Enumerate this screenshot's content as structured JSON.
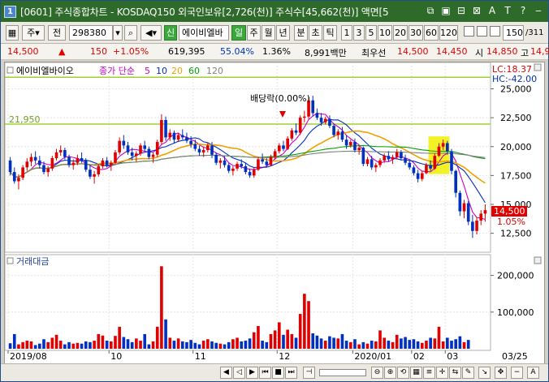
{
  "window": {
    "badge": "1",
    "title": "[0601] 주식종합차트 - KOSDAQ150 외국인보유[2,726(천)] 주식수[45,662(천)] 액면[5"
  },
  "title_icons": [
    "⧉",
    "▣",
    "⊟",
    "⊠",
    "A",
    "T",
    "?",
    "‒"
  ],
  "toolbar": {
    "type_label": "주",
    "prev_label": "전",
    "code_value": "298380",
    "search_icon": "magnifier-icon",
    "new_label": "신",
    "stock_name": "에이비엘바",
    "periods": [
      "일",
      "주",
      "월",
      "년",
      "분",
      "초",
      "틱"
    ],
    "multipliers": [
      "1",
      "3",
      "5",
      "10",
      "20",
      "30",
      "60",
      "120"
    ],
    "count_value": "150",
    "count_total": "/311"
  },
  "inforow": {
    "price": "14,500",
    "change": "150",
    "change_pct": "+1.05%",
    "volume": "619,395",
    "ratio1": "55.04%",
    "ratio2": "1.36%",
    "amount": "8,991백만",
    "pref_label": "최우선",
    "bid1": "14,500",
    "bid2": "14,450",
    "open_label": "시",
    "open": "14,850",
    "high_label": "고",
    "high": "14,9"
  },
  "chart": {
    "legend_name": "에이비엘바이오",
    "legend_ma_label": "종가 단순",
    "ma_periods": [
      "5",
      "10",
      "20",
      "60",
      "120"
    ],
    "ma_colors": [
      "#cc00cc",
      "#0030c0",
      "#f0a000",
      "#00a000",
      "#808080"
    ],
    "lc_label": "LC:18.37",
    "hc_label": "HC:-42.00",
    "resistance_label": "21,950",
    "dividend_label": "배당락(0.00%)",
    "price_ticks": [
      "25,000",
      "22,500",
      "20,000",
      "17,500",
      "15,000",
      "12,500"
    ],
    "current_price": "14,500",
    "current_pct": "1.05%",
    "volume_label": "거래대금",
    "volume_ticks": [
      "200,000",
      "100,000"
    ],
    "date_ticks": [
      "2019/08",
      "10",
      "11",
      "12",
      "2020/01",
      "02",
      "03"
    ],
    "last_date": "03/25"
  },
  "chart_data": {
    "type": "candlestick",
    "price_axis": {
      "min": 11000,
      "max": 27000,
      "ticks": [
        25000,
        22500,
        20000,
        17500,
        15000,
        12500
      ]
    },
    "volume_axis": {
      "max": 250000,
      "ticks": [
        200000,
        100000
      ]
    },
    "resistance": 21950,
    "support": 26000,
    "candles": [
      [
        18800,
        19100,
        17500,
        17800
      ],
      [
        17800,
        18200,
        16800,
        17000
      ],
      [
        17000,
        17600,
        16300,
        17300
      ],
      [
        17300,
        18400,
        17100,
        18200
      ],
      [
        18200,
        19000,
        17900,
        18700
      ],
      [
        18700,
        19400,
        18300,
        19100
      ],
      [
        19100,
        19600,
        18500,
        18800
      ],
      [
        18800,
        19200,
        18100,
        18400
      ],
      [
        18400,
        18700,
        17600,
        17800
      ],
      [
        17800,
        18300,
        17400,
        18100
      ],
      [
        18100,
        19200,
        17900,
        19000
      ],
      [
        19000,
        19800,
        18800,
        19500
      ],
      [
        19500,
        20100,
        19200,
        19700
      ],
      [
        19700,
        19900,
        18900,
        19100
      ],
      [
        19100,
        19300,
        18200,
        18400
      ],
      [
        18400,
        18900,
        18000,
        18600
      ],
      [
        18600,
        19300,
        18400,
        19000
      ],
      [
        19000,
        19500,
        18600,
        18800
      ],
      [
        18800,
        19000,
        17800,
        18000
      ],
      [
        18000,
        18400,
        17200,
        17400
      ],
      [
        17400,
        17900,
        16800,
        17600
      ],
      [
        17600,
        18500,
        17400,
        18300
      ],
      [
        18300,
        19000,
        18100,
        18800
      ],
      [
        18800,
        19100,
        18200,
        18400
      ],
      [
        18400,
        18800,
        17900,
        18600
      ],
      [
        18600,
        19700,
        18500,
        19500
      ],
      [
        19500,
        20800,
        19300,
        20500
      ],
      [
        20500,
        21000,
        19800,
        20100
      ],
      [
        20100,
        20400,
        19300,
        19500
      ],
      [
        19500,
        19900,
        18800,
        19200
      ],
      [
        19200,
        19600,
        18700,
        19400
      ],
      [
        19400,
        20300,
        19200,
        20100
      ],
      [
        20100,
        20500,
        19600,
        19800
      ],
      [
        19800,
        20000,
        18900,
        19100
      ],
      [
        19100,
        19500,
        18600,
        19300
      ],
      [
        19300,
        20600,
        19100,
        20400
      ],
      [
        20400,
        22800,
        20200,
        22300
      ],
      [
        22300,
        22600,
        20500,
        20800
      ],
      [
        20800,
        21500,
        20500,
        21200
      ],
      [
        21200,
        21400,
        20300,
        20600
      ],
      [
        20600,
        21200,
        20400,
        21000
      ],
      [
        21000,
        21500,
        20600,
        20800
      ],
      [
        20800,
        21200,
        20300,
        20500
      ],
      [
        20500,
        20900,
        19900,
        20200
      ],
      [
        20200,
        20600,
        19600,
        19800
      ],
      [
        19800,
        20100,
        19200,
        19500
      ],
      [
        19500,
        20000,
        19100,
        19700
      ],
      [
        19700,
        20300,
        19500,
        20100
      ],
      [
        20100,
        20400,
        19000,
        19300
      ],
      [
        19300,
        19500,
        18400,
        18600
      ],
      [
        18600,
        19000,
        18100,
        18800
      ],
      [
        18800,
        19200,
        18200,
        18400
      ],
      [
        18400,
        18600,
        17700,
        17900
      ],
      [
        17900,
        18300,
        17500,
        18100
      ],
      [
        18100,
        18700,
        17900,
        18500
      ],
      [
        18500,
        18900,
        18100,
        18300
      ],
      [
        18300,
        18600,
        17600,
        17800
      ],
      [
        17800,
        18100,
        17300,
        17500
      ],
      [
        17500,
        18200,
        17300,
        18000
      ],
      [
        18000,
        19100,
        17900,
        18900
      ],
      [
        18900,
        19400,
        18500,
        18700
      ],
      [
        18700,
        19000,
        18200,
        18400
      ],
      [
        18400,
        19300,
        18300,
        19100
      ],
      [
        19100,
        19800,
        18900,
        19600
      ],
      [
        19600,
        20300,
        19400,
        20100
      ],
      [
        20100,
        20500,
        19600,
        19800
      ],
      [
        19800,
        20900,
        19700,
        20700
      ],
      [
        20700,
        21600,
        20500,
        21400
      ],
      [
        21400,
        22000,
        21000,
        21200
      ],
      [
        21200,
        22700,
        21000,
        22500
      ],
      [
        22500,
        23100,
        22100,
        22600
      ],
      [
        22600,
        24300,
        22400,
        24000
      ],
      [
        24000,
        24400,
        22600,
        22900
      ],
      [
        22900,
        23300,
        22300,
        22500
      ],
      [
        22500,
        22900,
        21800,
        22100
      ],
      [
        22100,
        22600,
        21900,
        22400
      ],
      [
        22400,
        22700,
        21600,
        21800
      ],
      [
        21800,
        22000,
        20800,
        21000
      ],
      [
        21000,
        21500,
        20600,
        21300
      ],
      [
        21300,
        21700,
        20400,
        20600
      ],
      [
        20600,
        21000,
        19800,
        20100
      ],
      [
        20100,
        20600,
        19900,
        20400
      ],
      [
        20400,
        20700,
        19500,
        19700
      ],
      [
        19700,
        20100,
        19300,
        19900
      ],
      [
        19900,
        20000,
        18300,
        18500
      ],
      [
        18500,
        19100,
        18300,
        18900
      ],
      [
        18900,
        19200,
        18000,
        18200
      ],
      [
        18200,
        18600,
        17800,
        18400
      ],
      [
        18400,
        19000,
        18200,
        18800
      ],
      [
        18800,
        19400,
        18600,
        19200
      ],
      [
        19200,
        19600,
        18700,
        18900
      ],
      [
        18900,
        19300,
        18500,
        19100
      ],
      [
        19100,
        19800,
        18900,
        19500
      ],
      [
        19500,
        19700,
        18800,
        19000
      ],
      [
        19000,
        19300,
        18400,
        18600
      ],
      [
        18600,
        18900,
        18000,
        18200
      ],
      [
        18200,
        18400,
        17500,
        17700
      ],
      [
        17700,
        18000,
        16900,
        17200
      ],
      [
        17200,
        17900,
        17000,
        17700
      ],
      [
        17700,
        18600,
        17600,
        18400
      ],
      [
        18400,
        18800,
        17900,
        18100
      ],
      [
        18100,
        19400,
        18000,
        19200
      ],
      [
        19200,
        20300,
        19100,
        20000
      ],
      [
        20000,
        20600,
        19700,
        20300
      ],
      [
        20300,
        20500,
        19300,
        19600
      ],
      [
        19600,
        19800,
        17600,
        17900
      ],
      [
        17900,
        18000,
        15600,
        16000
      ],
      [
        16000,
        16200,
        14000,
        14400
      ],
      [
        14400,
        15400,
        13800,
        15100
      ],
      [
        15100,
        15300,
        13200,
        13500
      ],
      [
        13500,
        14100,
        12100,
        12700
      ],
      [
        12700,
        13900,
        12400,
        13600
      ],
      [
        13600,
        14500,
        13200,
        14200
      ],
      [
        14200,
        15000,
        13500,
        14500
      ]
    ],
    "volumes": [
      15,
      40,
      12,
      18,
      22,
      20,
      10,
      14,
      26,
      18,
      30,
      38,
      22,
      12,
      18,
      14,
      16,
      14,
      20,
      18,
      22,
      40,
      36,
      22,
      20,
      35,
      60,
      32,
      26,
      18,
      28,
      22,
      40,
      12,
      20,
      60,
      225,
      80,
      30,
      22,
      28,
      20,
      18,
      24,
      16,
      12,
      22,
      26,
      20,
      16,
      14,
      12,
      18,
      26,
      30,
      20,
      22,
      28,
      45,
      62,
      22,
      18,
      40,
      50,
      72,
      38,
      52,
      40,
      30,
      95,
      150,
      130,
      42,
      36,
      28,
      22,
      34,
      30,
      28,
      40,
      22,
      18,
      26,
      12,
      18,
      14,
      22,
      20,
      50,
      30,
      22,
      18,
      38,
      28,
      32,
      24,
      26,
      20,
      16,
      22,
      30,
      28,
      60,
      20,
      30,
      22,
      26,
      34,
      18,
      24
    ],
    "sma5": null,
    "highlight": {
      "from_index": 100,
      "to_index": 104,
      "color": "#f0f000"
    }
  }
}
